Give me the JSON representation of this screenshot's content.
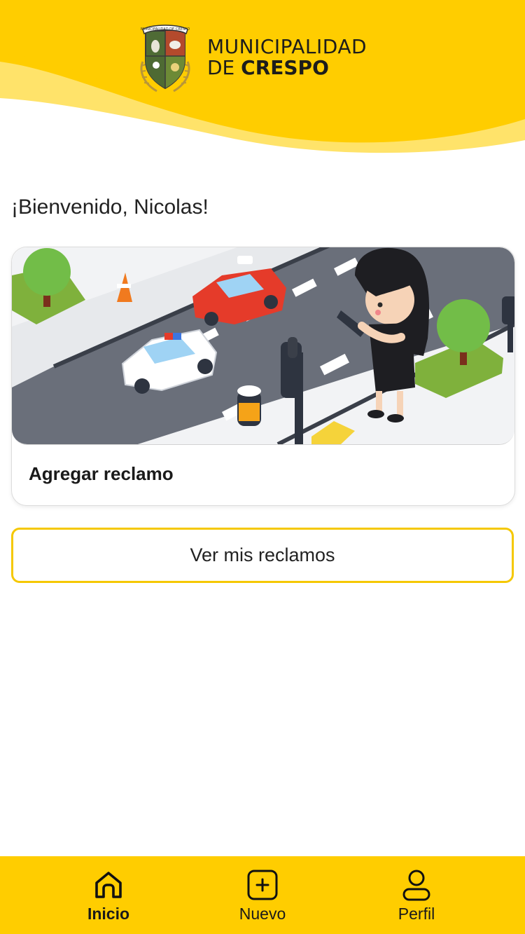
{
  "header": {
    "brand_line1": "MUNICIPALIDAD",
    "brand_line2_prefix": "DE ",
    "brand_line2_bold": "CRESPO",
    "logo_ribbon": "MUNICIPALIDAD DE CRESPO",
    "logo_icon": "crespo-coat-of-arms-icon",
    "brand_color": "#FFCD00"
  },
  "main": {
    "greeting": "¡Bienvenido, Nicolas!",
    "card": {
      "title": "Agregar reclamo",
      "illustration": "street-complaint-illustration"
    },
    "view_button_label": "Ver mis reclamos",
    "accent_color": "#F5C800"
  },
  "tabbar": {
    "tabs": [
      {
        "label": "Inicio",
        "icon": "home-icon",
        "active": true
      },
      {
        "label": "Nuevo",
        "icon": "plus-square-icon",
        "active": false
      },
      {
        "label": "Perfil",
        "icon": "user-icon",
        "active": false
      }
    ]
  }
}
